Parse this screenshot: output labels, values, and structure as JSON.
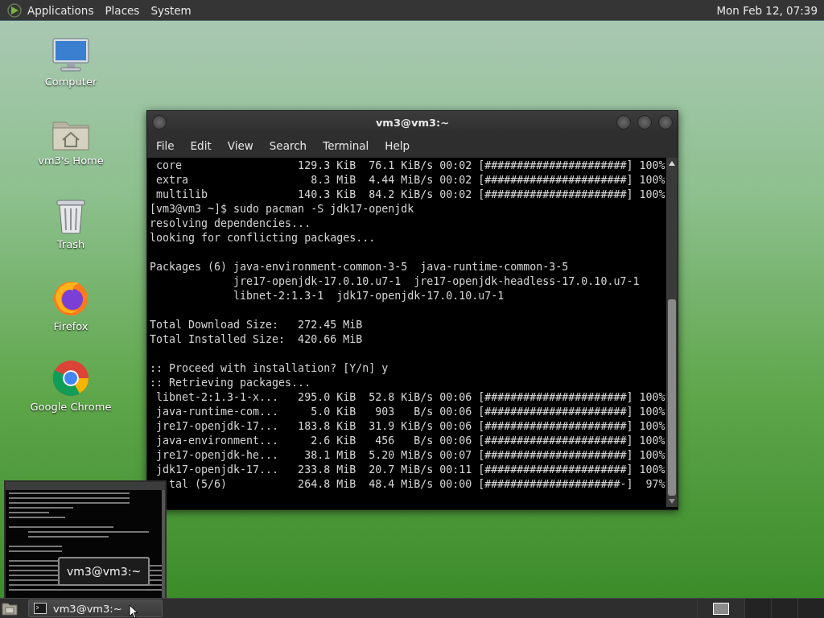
{
  "top_panel": {
    "menus": [
      "Applications",
      "Places",
      "System"
    ],
    "clock": "Mon Feb 12, 07:39"
  },
  "desktop_icons": [
    {
      "label": "Computer",
      "kind": "computer"
    },
    {
      "label": "vm3's Home",
      "kind": "home"
    },
    {
      "label": "Trash",
      "kind": "trash"
    },
    {
      "label": "Firefox",
      "kind": "firefox"
    },
    {
      "label": "Google Chrome",
      "kind": "chrome"
    }
  ],
  "terminal": {
    "title": "vm3@vm3:~",
    "menu": [
      "File",
      "Edit",
      "View",
      "Search",
      "Terminal",
      "Help"
    ],
    "lines": [
      {
        "kind": "text",
        "text": " core                  129.3 KiB  76.1 KiB/s 00:02 [######################] 100%"
      },
      {
        "kind": "text",
        "text": " extra                   8.3 MiB  4.44 MiB/s 00:02 [######################] 100%"
      },
      {
        "kind": "text",
        "text": " multilib              140.3 KiB  84.2 KiB/s 00:02 [######################] 100%"
      },
      {
        "kind": "text",
        "text": "[vm3@vm3 ~]$ sudo pacman -S jdk17-openjdk"
      },
      {
        "kind": "text",
        "text": "resolving dependencies..."
      },
      {
        "kind": "text",
        "text": "looking for conflicting packages..."
      },
      {
        "kind": "blank"
      },
      {
        "kind": "text",
        "text": "Packages (6) java-environment-common-3-5  java-runtime-common-3-5"
      },
      {
        "kind": "text",
        "text": "             jre17-openjdk-17.0.10.u7-1  jre17-openjdk-headless-17.0.10.u7-1"
      },
      {
        "kind": "text",
        "text": "             libnet-2:1.3-1  jdk17-openjdk-17.0.10.u7-1"
      },
      {
        "kind": "blank"
      },
      {
        "kind": "text",
        "text": "Total Download Size:   272.45 MiB"
      },
      {
        "kind": "text",
        "text": "Total Installed Size:  420.66 MiB"
      },
      {
        "kind": "blank"
      },
      {
        "kind": "text",
        "text": ":: Proceed with installation? [Y/n] y"
      },
      {
        "kind": "text",
        "text": ":: Retrieving packages..."
      },
      {
        "kind": "text",
        "text": " libnet-2:1.3-1-x...   295.0 KiB  52.8 KiB/s 00:06 [######################] 100%"
      },
      {
        "kind": "text",
        "text": " java-runtime-com...     5.0 KiB   903   B/s 00:06 [######################] 100%"
      },
      {
        "kind": "text",
        "text": " jre17-openjdk-17...   183.8 KiB  31.9 KiB/s 00:06 [######################] 100%"
      },
      {
        "kind": "text",
        "text": " java-environment...     2.6 KiB   456   B/s 00:06 [######################] 100%"
      },
      {
        "kind": "text",
        "text": " jre17-openjdk-he...    38.1 MiB  5.20 MiB/s 00:07 [######################] 100%"
      },
      {
        "kind": "text",
        "text": " jdk17-openjdk-17...   233.8 MiB  20.7 MiB/s 00:11 [######################] 100%"
      },
      {
        "kind": "text",
        "text": "   tal (5/6)           264.8 MiB  48.4 MiB/s 00:00 [#####################-]  97%"
      }
    ]
  },
  "preview": {
    "tooltip": "vm3@vm3:~"
  },
  "taskbar": {
    "tasks": [
      {
        "label": "vm3@vm3:~"
      }
    ],
    "workspaces": [
      {
        "selected": true
      },
      {
        "selected": false
      },
      {
        "selected": false
      },
      {
        "selected": false
      }
    ]
  }
}
